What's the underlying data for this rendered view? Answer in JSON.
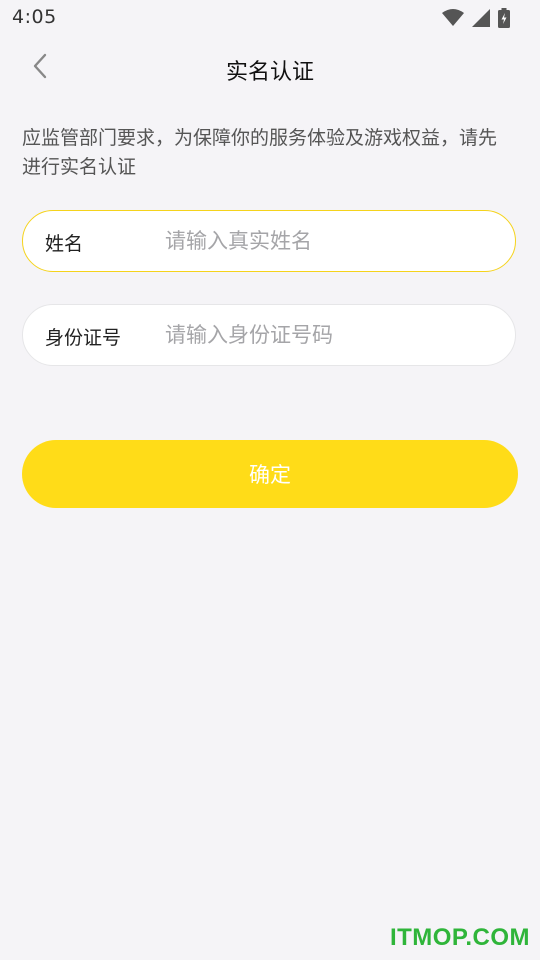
{
  "status_bar": {
    "time": "4:05",
    "icons": [
      "wifi-icon",
      "cell-signal-icon",
      "battery-charging-icon"
    ]
  },
  "nav": {
    "title": "实名认证",
    "back_icon": "chevron-left-icon"
  },
  "notice": "应监管部门要求，为保障你的服务体验及游戏权益，请先进行实名认证",
  "form": {
    "name": {
      "label": "姓名",
      "placeholder": "请输入真实姓名",
      "value": ""
    },
    "id_number": {
      "label": "身份证号",
      "placeholder": "请输入身份证号码",
      "value": ""
    },
    "submit_label": "确定"
  },
  "watermark": "ITMOP.COM",
  "colors": {
    "accent": "#ffdc18",
    "active_border": "#f5d31c",
    "background": "#f5f4f7",
    "watermark": "#2fb53a"
  }
}
